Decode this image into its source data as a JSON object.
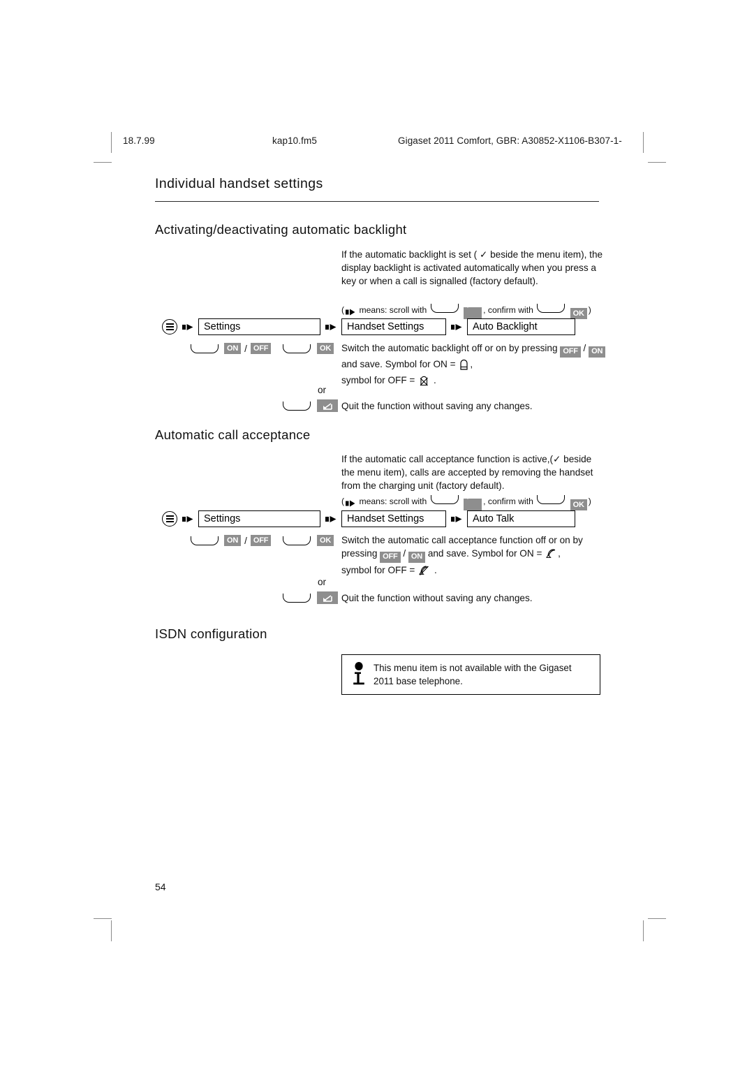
{
  "header": {
    "date": "18.7.99",
    "filename": "kap10.fm5",
    "document": "Gigaset 2011 Comfort, GBR: A30852-X1106-B307-1-"
  },
  "chapter_title": "Individual handset settings",
  "sections": [
    {
      "heading": "Activating/deactivating automatic backlight",
      "intro": "If the automatic backlight is set ( ✓ beside the menu item), the display backlight is activated automatically when you press a key or when a call is signalled (factory default).",
      "hint_prefix": "(",
      "hint_means": "means: scroll with",
      "hint_confirm": ", confirm with",
      "hint_ok": "OK",
      "hint_suffix": ")",
      "path": {
        "menu_icon": "menu-icon",
        "step1": "Settings",
        "step2": "Handset Settings",
        "step3": "Auto Backlight"
      },
      "keys": {
        "on": "ON",
        "slash": "/",
        "off": "OFF",
        "ok": "OK"
      },
      "description_1": "Switch the automatic backlight off or on by pressing",
      "description_tag_off": "OFF",
      "description_slash": "/",
      "description_tag_on": "ON",
      "description_2": "and save. Symbol for ON =",
      "description_comma": ",",
      "description_3": "symbol for OFF =",
      "description_period": ".",
      "or_label": "or",
      "quit_text": "Quit the function without saving any changes."
    },
    {
      "heading": "Automatic call acceptance",
      "intro": "If the automatic call acceptance function is active,(✓ beside the menu item), calls are accepted by removing the handset from the charging unit (factory default).",
      "hint_prefix": "(",
      "hint_means": "means: scroll with",
      "hint_confirm": ", confirm with",
      "hint_ok": "OK",
      "hint_suffix": ")",
      "path": {
        "menu_icon": "menu-icon",
        "step1": "Settings",
        "step2": "Handset Settings",
        "step3": "Auto Talk"
      },
      "keys": {
        "on": "ON",
        "slash": "/",
        "off": "OFF",
        "ok": "OK"
      },
      "description_1": "Switch the automatic call acceptance function off or on by pressing",
      "description_tag_off": "OFF",
      "description_slash": "/",
      "description_tag_on": "ON",
      "description_2": "and save. Symbol for ON =",
      "description_comma": ",",
      "description_3": "symbol for OFF =",
      "description_period": ".",
      "or_label": "or",
      "quit_text": "Quit the function without saving any changes."
    },
    {
      "heading": "ISDN configuration",
      "note": "This menu item is not available with the Gigaset 2011 base telephone."
    }
  ],
  "page_number": "54"
}
